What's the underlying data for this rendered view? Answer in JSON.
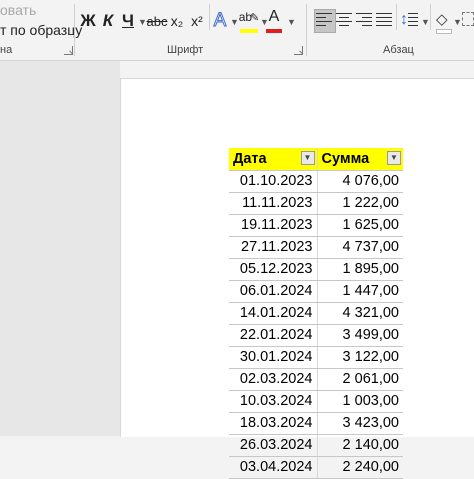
{
  "ribbon": {
    "clipboard": {
      "row1": "овать",
      "row2": "т по образцу",
      "group_label": "на"
    },
    "font": {
      "bold": "Ж",
      "italic": "К",
      "underline": "Ч",
      "strike": "abc",
      "subscript": "x₂",
      "superscript": "x²",
      "text_effects": "A",
      "highlight": "ab",
      "font_color": "A",
      "group_label": "Шрифт",
      "highlight_color": "#ffff00",
      "font_color_value": "#e02020"
    },
    "paragraph": {
      "group_label": "Абзац"
    }
  },
  "table": {
    "headers": [
      "Дата",
      "Сумма"
    ],
    "header_color": "#ffff00",
    "rows": [
      [
        "01.10.2023",
        "4 076,00"
      ],
      [
        "11.11.2023",
        "1 222,00"
      ],
      [
        "19.11.2023",
        "1 625,00"
      ],
      [
        "27.11.2023",
        "4 737,00"
      ],
      [
        "05.12.2023",
        "1 895,00"
      ],
      [
        "06.01.2024",
        "1 447,00"
      ],
      [
        "14.01.2024",
        "4 321,00"
      ],
      [
        "22.01.2024",
        "3 499,00"
      ],
      [
        "30.01.2024",
        "3 122,00"
      ],
      [
        "02.03.2024",
        "2 061,00"
      ],
      [
        "10.03.2024",
        "1 003,00"
      ],
      [
        "18.03.2024",
        "3 423,00"
      ],
      [
        "26.03.2024",
        "2 140,00"
      ],
      [
        "03.04.2024",
        "2 240,00"
      ]
    ]
  }
}
